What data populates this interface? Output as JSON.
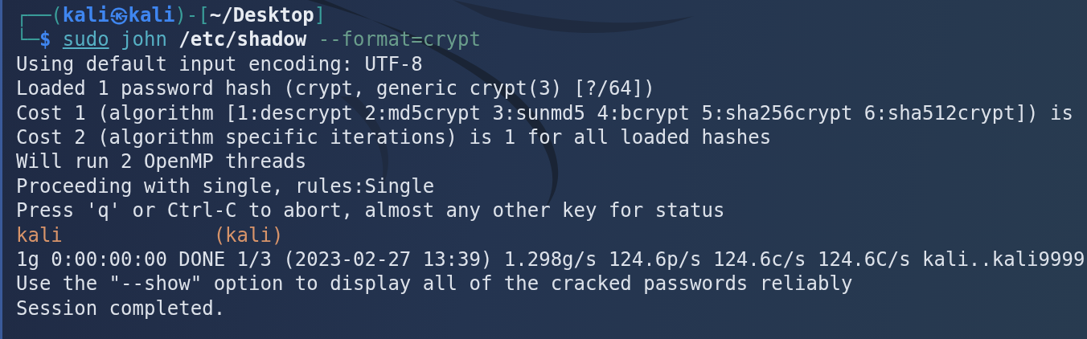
{
  "terminal": {
    "lines": [
      {
        "segments": [
          {
            "text": "┌──(",
            "kind": "frame"
          },
          {
            "text": "kali㉿kali",
            "kind": "user"
          },
          {
            "text": ")-[",
            "kind": "frame"
          },
          {
            "text": "~/Desktop",
            "kind": "path"
          },
          {
            "text": "]",
            "kind": "frame"
          }
        ]
      },
      {
        "segments": [
          {
            "text": "└─",
            "kind": "frame"
          },
          {
            "text": "$",
            "kind": "user"
          },
          {
            "text": " sudo",
            "kind": "command-underlined"
          },
          {
            "text": " john",
            "kind": "command"
          },
          {
            "text": " /etc/shadow",
            "kind": "path"
          },
          {
            "text": " --format=crypt",
            "kind": "option"
          }
        ]
      },
      {
        "segments": [
          {
            "text": "Using default input encoding: UTF-8",
            "kind": "output"
          }
        ]
      },
      {
        "segments": [
          {
            "text": "Loaded 1 password hash (crypt, generic crypt(3) [?/64])",
            "kind": "output"
          }
        ]
      },
      {
        "segments": [
          {
            "text": "Cost 1 (algorithm [1:descrypt 2:md5crypt 3:sunmd5 4:bcrypt 5:sha256crypt 6:sha512crypt]) is",
            "kind": "output"
          }
        ]
      },
      {
        "segments": [
          {
            "text": "Cost 2 (algorithm specific iterations) is 1 for all loaded hashes",
            "kind": "output"
          }
        ]
      },
      {
        "segments": [
          {
            "text": "Will run 2 OpenMP threads",
            "kind": "output"
          }
        ]
      },
      {
        "segments": [
          {
            "text": "Proceeding with single, rules:Single",
            "kind": "output"
          }
        ]
      },
      {
        "segments": [
          {
            "text": "Press 'q' or Ctrl-C to abort, almost any other key for status",
            "kind": "output"
          }
        ]
      },
      {
        "segments": [
          {
            "text": "kali",
            "kind": "found"
          },
          {
            "text": "             (kali)",
            "kind": "found"
          }
        ]
      },
      {
        "segments": [
          {
            "text": "1g 0:00:00:00 DONE 1/3 (2023-02-27 13:39) 1.298g/s 124.6p/s 124.6c/s 124.6C/s kali..kali9999",
            "kind": "output"
          }
        ]
      },
      {
        "segments": [
          {
            "text": "Use the \"--show\" option to display all of the cracked passwords reliably",
            "kind": "output"
          }
        ]
      },
      {
        "segments": [
          {
            "text": "Session completed.",
            "kind": "output"
          }
        ]
      }
    ]
  }
}
